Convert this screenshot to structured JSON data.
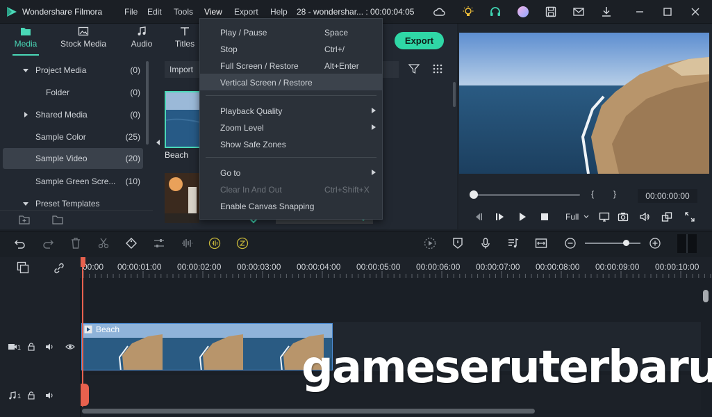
{
  "titlebar": {
    "app_name": "Wondershare Filmora",
    "menus": [
      "File",
      "Edit",
      "Tools",
      "View",
      "Export",
      "Help"
    ],
    "document": "28 - wondershar... : 00:00:04:05"
  },
  "tabs": [
    "Media",
    "Stock Media",
    "Audio",
    "Titles"
  ],
  "tree": [
    {
      "label": "Project Media",
      "count": "(0)"
    },
    {
      "label": "Folder",
      "count": "(0)"
    },
    {
      "label": "Shared Media",
      "count": "(0)"
    },
    {
      "label": "Sample Color",
      "count": "(25)"
    },
    {
      "label": "Sample Video",
      "count": "(20)"
    },
    {
      "label": "Sample Green Scre...",
      "count": "(10)"
    },
    {
      "label": "Preset Templates",
      "count": ""
    }
  ],
  "media": {
    "import_label": "Import",
    "thumb_label": "Beach"
  },
  "view_menu": {
    "items": [
      {
        "label": "Play / Pause",
        "shortcut": "Space"
      },
      {
        "label": "Stop",
        "shortcut": "Ctrl+/"
      },
      {
        "label": "Full Screen / Restore",
        "shortcut": "Alt+Enter"
      },
      {
        "label": "Vertical Screen / Restore",
        "shortcut": ""
      },
      {
        "label": "Playback Quality",
        "shortcut": ""
      },
      {
        "label": "Zoom Level",
        "shortcut": ""
      },
      {
        "label": "Show Safe Zones",
        "shortcut": ""
      },
      {
        "label": "Go to",
        "shortcut": ""
      },
      {
        "label": "Clear In And Out",
        "shortcut": "Ctrl+Shift+X"
      },
      {
        "label": "Enable Canvas Snapping",
        "shortcut": ""
      }
    ]
  },
  "export_label": "Export",
  "preview": {
    "bracket_in": "{",
    "bracket_out": "}",
    "timecode": "00:00:00:00",
    "quality": "Full"
  },
  "ruler": [
    "00:00",
    "00:00:01:00",
    "00:00:02:00",
    "00:00:03:00",
    "00:00:04:00",
    "00:00:05:00",
    "00:00:06:00",
    "00:00:07:00",
    "00:00:08:00",
    "00:00:09:00",
    "00:00:10:00"
  ],
  "tracks": {
    "video_num": "1",
    "audio_num": "1",
    "clip_label": "Beach"
  },
  "watermark": "gameseruterbaru",
  "colors": {
    "accent": "#4ad8b7",
    "export": "#2fd7a6",
    "playhead": "#e8614e",
    "clip": "#24507e"
  }
}
